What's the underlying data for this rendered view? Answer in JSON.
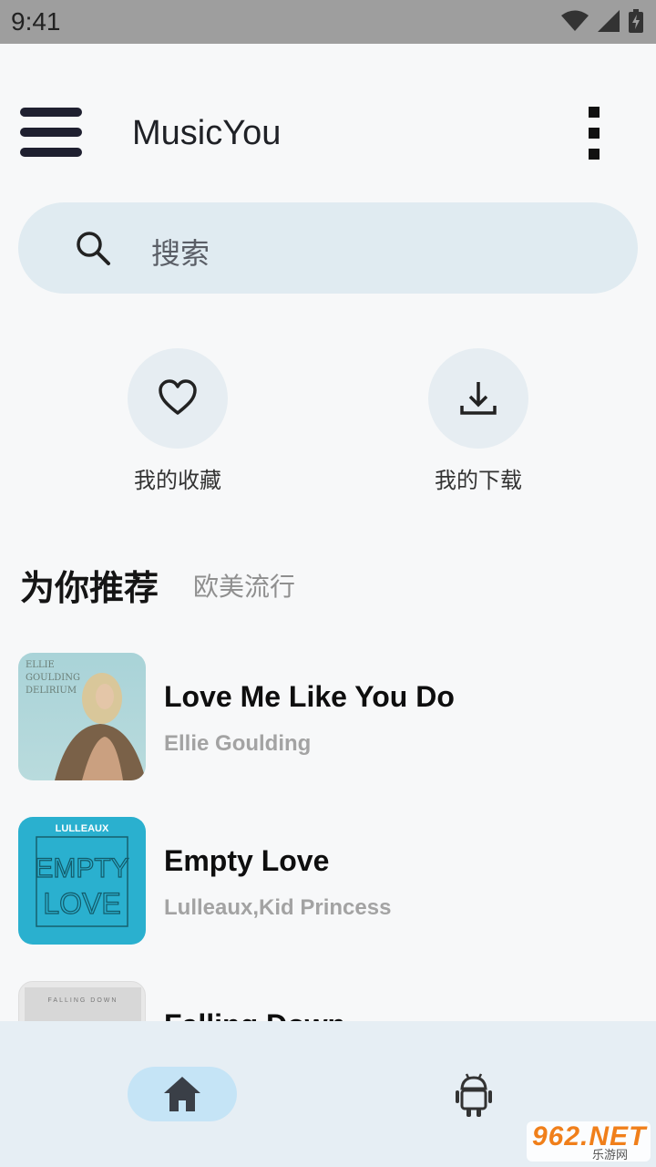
{
  "status_bar": {
    "time": "9:41"
  },
  "app_bar": {
    "title": "MusicYou"
  },
  "search": {
    "placeholder": "搜索"
  },
  "quick_actions": [
    {
      "label": "我的收藏",
      "icon": "heart-icon"
    },
    {
      "label": "我的下载",
      "icon": "download-icon"
    }
  ],
  "recommend": {
    "title": "为你推荐",
    "subtitle": "欧美流行"
  },
  "songs": [
    {
      "title": "Love Me Like You Do",
      "artist": "Ellie Goulding",
      "cover_lines": [
        "ELLIE",
        "GOULDING",
        "DELIRIUM"
      ]
    },
    {
      "title": "Empty Love",
      "artist": "Lulleaux,Kid Princess",
      "cover_lines": [
        "LULLEAUX",
        "EMPTY",
        "LOVE"
      ]
    },
    {
      "title": "Falling Down",
      "artist": "",
      "cover_lines": [
        "FALLING DOWN"
      ]
    }
  ],
  "bottom_nav": [
    {
      "icon": "home-icon",
      "selected": true
    },
    {
      "icon": "android-icon",
      "selected": false
    }
  ],
  "watermark": {
    "top": "962.NET",
    "bottom": "乐游网"
  },
  "colors": {
    "accent": "#c5e4f6",
    "search_bg": "#e0ebf1",
    "nav_bg": "#e6eef4",
    "status_bar": "#9e9e9e"
  }
}
